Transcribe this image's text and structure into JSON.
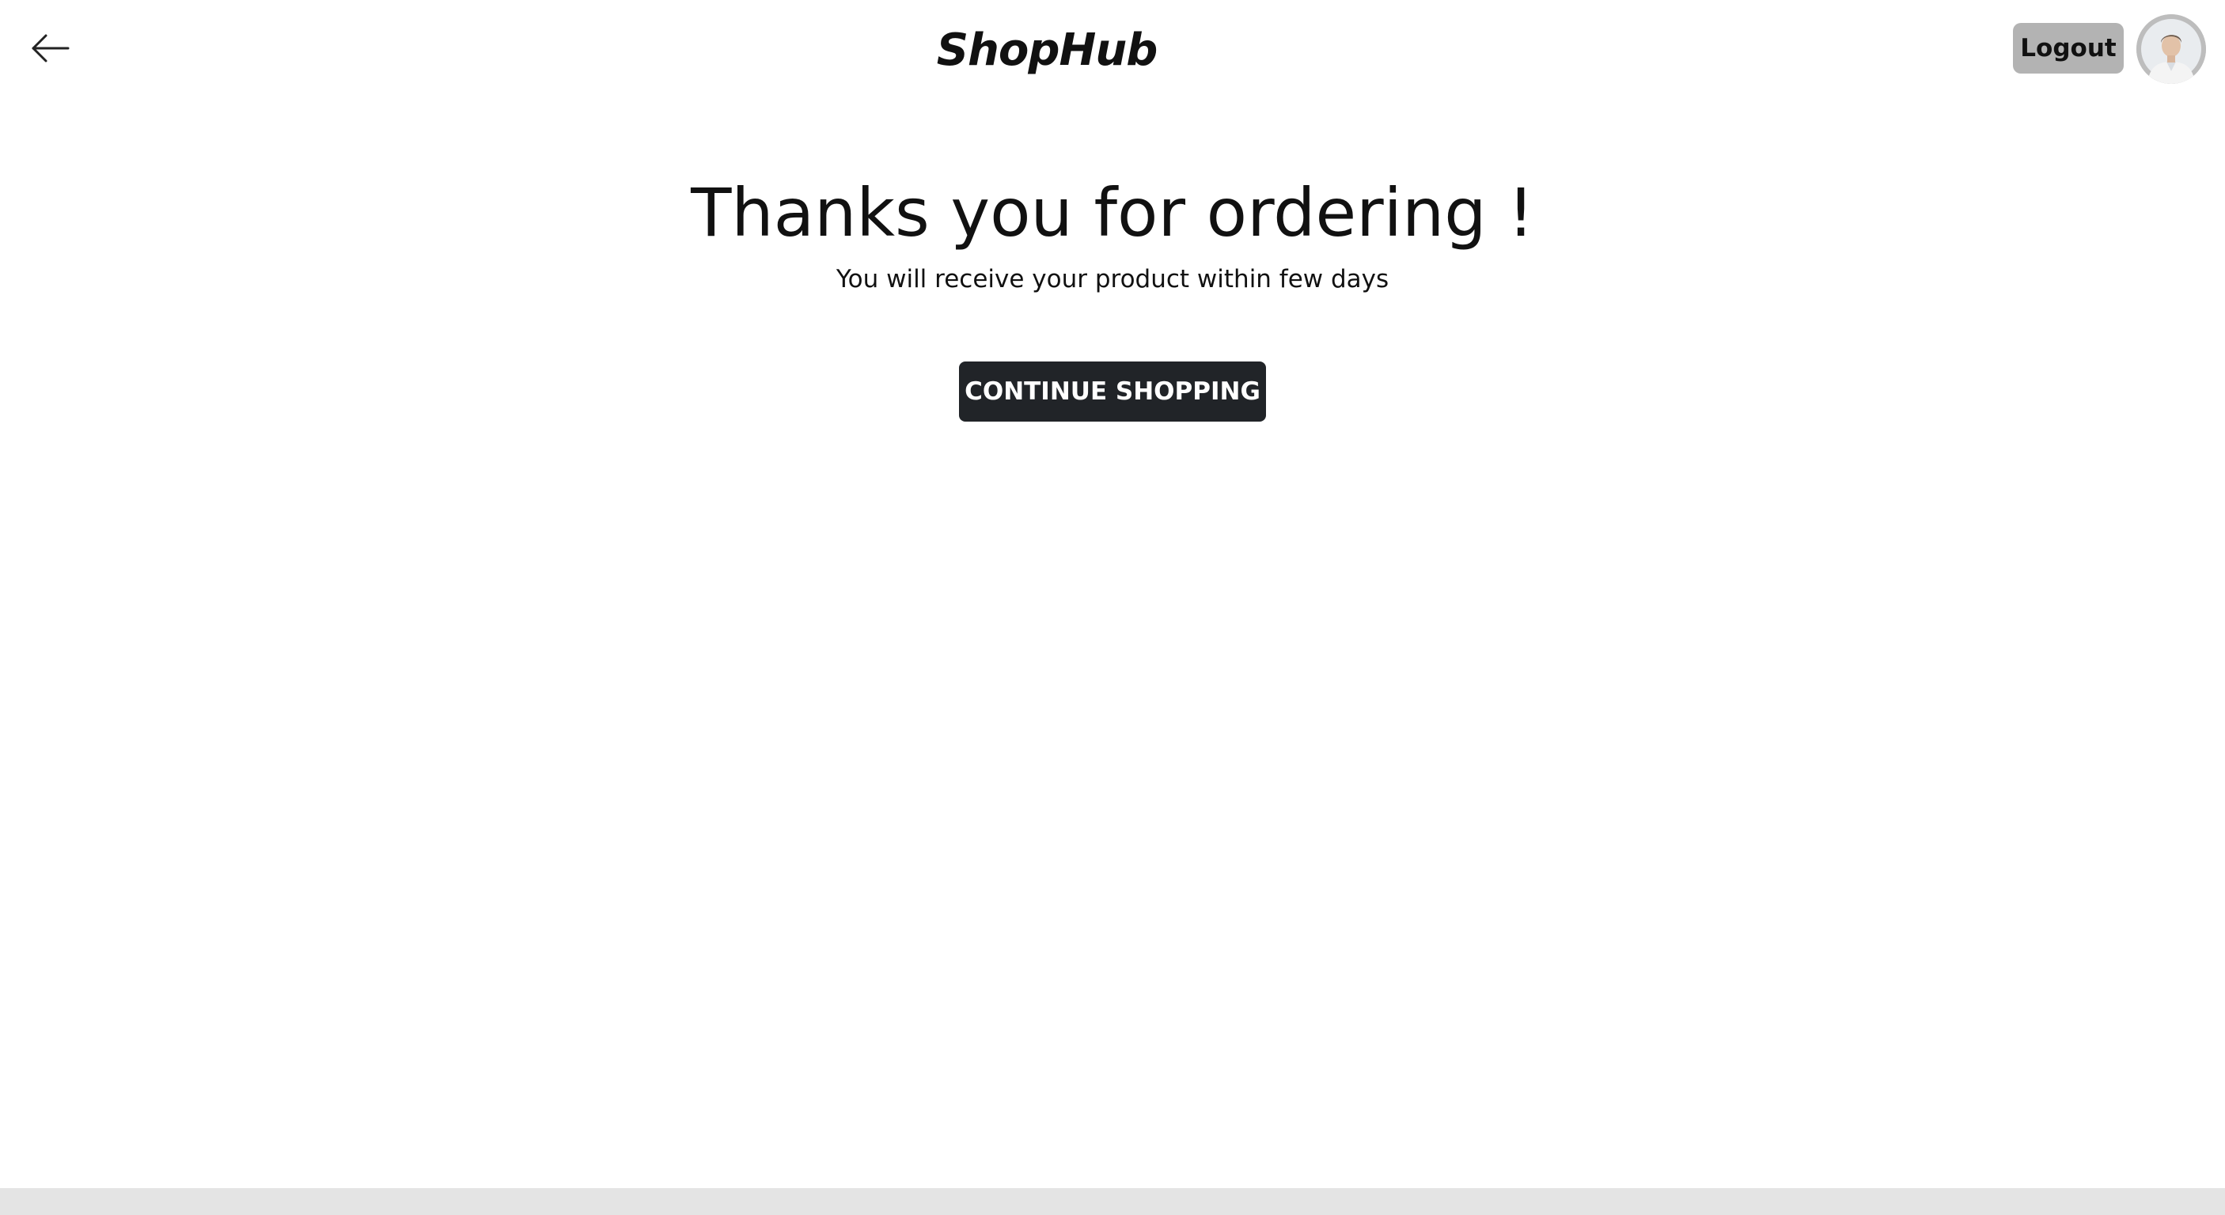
{
  "header": {
    "back_icon": "arrow-left-icon",
    "brand": "ShopHub",
    "logout_label": "Logout",
    "avatar_icon": "user-avatar"
  },
  "main": {
    "title": "Thanks you for ordering !",
    "subtitle": "You will receive your product within few days",
    "continue_label": "CONTINUE SHOPPING"
  },
  "colors": {
    "background": "#ffffff",
    "text": "#111111",
    "logout_bg": "#b3b3b3",
    "primary_button_bg": "#212428",
    "primary_button_text": "#ffffff",
    "bottom_bar": "#e4e4e4"
  }
}
